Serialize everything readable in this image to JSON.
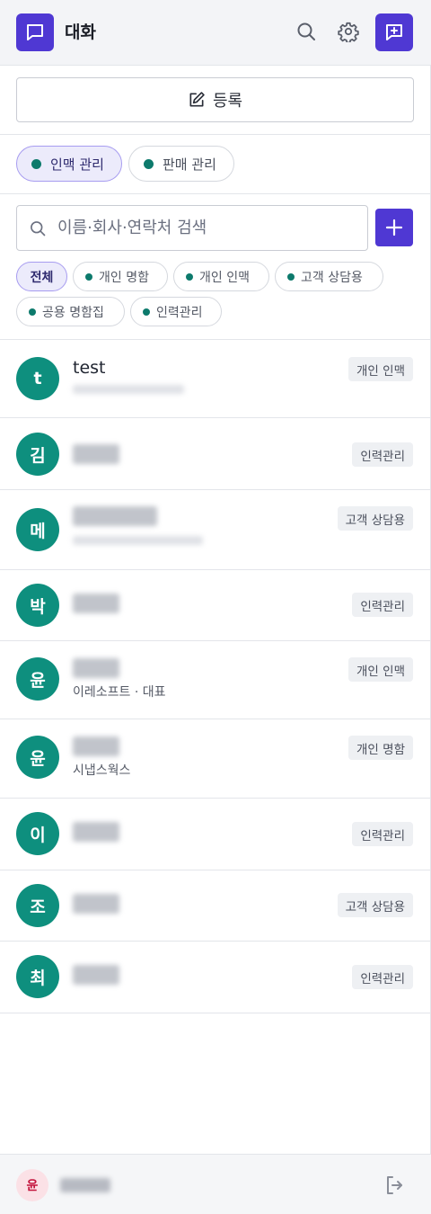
{
  "header": {
    "title": "대화"
  },
  "register": {
    "label": "등록"
  },
  "category_tabs": [
    {
      "label": "인맥 관리",
      "active": true
    },
    {
      "label": "판매 관리",
      "active": false
    }
  ],
  "search": {
    "placeholder": "이름·회사·연락처 검색",
    "value": ""
  },
  "filters": [
    {
      "label": "전체",
      "active": true
    },
    {
      "label": "개인 명함"
    },
    {
      "label": "개인 인맥"
    },
    {
      "label": "고객 상담용"
    },
    {
      "label": "공용 명함집"
    },
    {
      "label": "인력관리"
    }
  ],
  "contacts": [
    {
      "initial": "t",
      "name": "test",
      "tag": "개인 인맥"
    },
    {
      "initial": "김",
      "tag": "인력관리"
    },
    {
      "initial": "메",
      "tag": "고객 상담용"
    },
    {
      "initial": "박",
      "tag": "인력관리"
    },
    {
      "initial": "윤",
      "subtitle": "이레소프트 · 대표",
      "tag": "개인 인맥"
    },
    {
      "initial": "윤",
      "subtitle": "시냅스웍스",
      "tag": "개인 명함"
    },
    {
      "initial": "이",
      "tag": "인력관리"
    },
    {
      "initial": "조",
      "tag": "고객 상담용"
    },
    {
      "initial": "최",
      "tag": "인력관리"
    }
  ],
  "footer": {
    "user_initial": "윤"
  },
  "colors": {
    "accent": "#4f38d3",
    "avatar": "#0e8f7e",
    "dot": "#0d7a6c"
  }
}
